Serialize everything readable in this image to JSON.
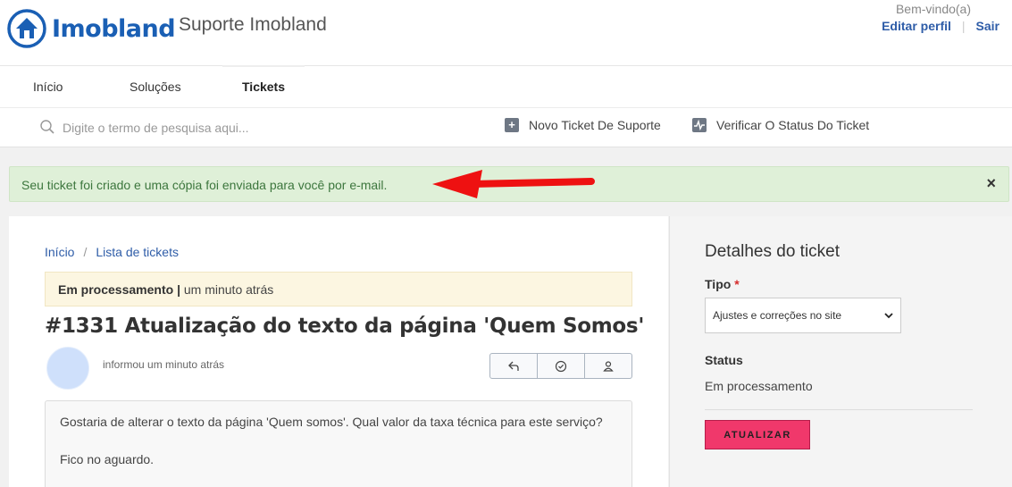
{
  "header": {
    "logo_text": "Imobland",
    "portal_name": "Suporte Imobland",
    "welcome": "Bem-vindo(a)",
    "edit_profile": "Editar perfil",
    "separator": "|",
    "logout": "Sair"
  },
  "nav": {
    "tabs": [
      {
        "label": "Início",
        "active": false
      },
      {
        "label": "Soluções",
        "active": false
      },
      {
        "label": "Tickets",
        "active": true
      }
    ]
  },
  "search": {
    "placeholder": "Digite o termo de pesquisa aqui...",
    "new_ticket": "Novo Ticket De Suporte",
    "check_status": "Verificar O Status Do Ticket"
  },
  "alert": {
    "message": "Seu ticket foi criado e uma cópia foi enviada para você por e-mail.",
    "close": "×",
    "arrow_color": "#ee1111"
  },
  "ticket": {
    "breadcrumb": [
      "Início",
      "Lista de tickets"
    ],
    "breadcrumb_sep": "/",
    "status_label": "Em processamento",
    "status_sep": "|",
    "status_time": "um minuto atrás",
    "title": "#1331 Atualização do texto da página 'Quem Somos'",
    "informed": "informou um minuto atrás",
    "actions": [
      "reply-icon",
      "check-circle-icon",
      "user-icon"
    ],
    "message_lines": [
      "Gostaria de alterar o texto da página 'Quem somos'. Qual  valor da taxa técnica para este serviço?",
      "Fico no aguardo."
    ]
  },
  "sidebar": {
    "title": "Detalhes do ticket",
    "tipo_label": "Tipo",
    "required_mark": "*",
    "tipo_value": "Ajustes e correções no site",
    "status_label": "Status",
    "status_value": "Em processamento",
    "update_button": "ATUALIZAR"
  },
  "colors": {
    "brand_blue": "#1a5fb4",
    "link_blue": "#2f5da8",
    "alert_green_bg": "#dff0d8",
    "alert_green_text": "#3c763d",
    "update_pink": "#f0386b"
  }
}
